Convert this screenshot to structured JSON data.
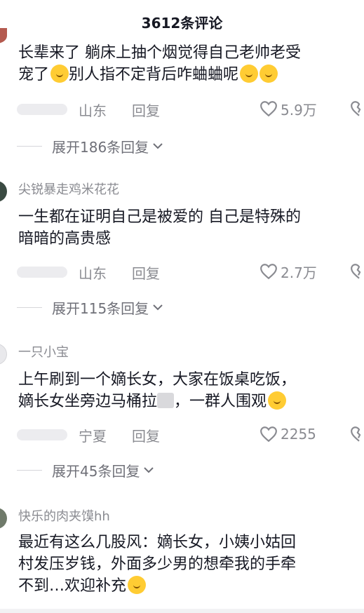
{
  "header": {
    "title": "3612条评论"
  },
  "comments": [
    {
      "username": "",
      "content_line1": "长辈来了 躺床上抽个烟觉得自己老帅老受",
      "content_line2a": "宠了",
      "content_line2b": "别人指不定背后咋蛐蛐呢",
      "location": "山东",
      "reply_label": "回复",
      "likes": "5.9万",
      "expand_label": "展开186条回复"
    },
    {
      "username": "尖锐暴走鸡米花花",
      "content_line1": "一生都在证明自己是被爱的 自己是特殊的",
      "content_line2": "暗暗的高贵感",
      "location": "山东",
      "reply_label": "回复",
      "likes": "2.7万",
      "expand_label": "展开115条回复"
    },
    {
      "username": "一只小宝",
      "content_line1": "上午刷到一个嫡长女，大家在饭桌吃饭，",
      "content_line2a": "嫡长女坐旁边马桶拉",
      "content_line2b": "，一群人围观",
      "location": "宁夏",
      "reply_label": "回复",
      "likes": "2255",
      "expand_label": "展开45条回复"
    },
    {
      "username": "快乐的肉夹馍hh",
      "content_line1": "最近有这么几股风：嫡长女，小姨小姑回",
      "content_line2": "村发压岁钱，外面多少男的想牵我的手牵",
      "content_line3": "不到…欢迎补充"
    }
  ],
  "icons": {
    "like": "heart-outline-icon",
    "dislike": "broken-heart-icon",
    "expand": "chevron-down-icon",
    "emoji": "emoji-icon"
  },
  "colors": {
    "text": "#161823",
    "muted": "#8a8b91",
    "emoji": "#ffcc33"
  }
}
